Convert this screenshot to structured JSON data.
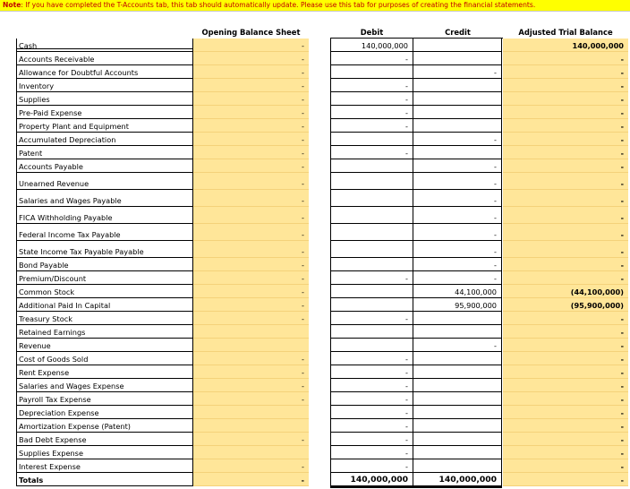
{
  "note": {
    "prefix": "Note",
    "text": ": If you have completed the T-Accounts tab, this tab should automatically update. Please use this tab for purposes of creating the financial statements."
  },
  "headers": {
    "opening": "Opening Balance Sheet",
    "debit": "Debit",
    "credit": "Credit",
    "adjusted": "Adjusted Trial Balance"
  },
  "rows": [
    {
      "label": "Cash",
      "opening": "-",
      "debit": "140,000,000",
      "credit": "",
      "adjusted": "140,000,000"
    },
    {
      "label": "Accounts Receivable",
      "opening": "-",
      "debit": "-",
      "credit": "",
      "adjusted": "-"
    },
    {
      "label": "Allowance for Doubtful Accounts",
      "opening": "-",
      "debit": "",
      "credit": "-",
      "adjusted": "-"
    },
    {
      "label": "Inventory",
      "opening": "-",
      "debit": "-",
      "credit": "",
      "adjusted": "-"
    },
    {
      "label": "Supplies",
      "opening": "-",
      "debit": "-",
      "credit": "",
      "adjusted": "-"
    },
    {
      "label": "Pre-Paid Expense",
      "opening": "-",
      "debit": "-",
      "credit": "",
      "adjusted": "-"
    },
    {
      "label": "Property Plant and Equipment",
      "opening": "-",
      "debit": "-",
      "credit": "",
      "adjusted": "-"
    },
    {
      "label": "Accumulated Depreciation",
      "opening": "-",
      "debit": "",
      "credit": "-",
      "adjusted": "-"
    },
    {
      "label": "Patent",
      "opening": "-",
      "debit": "-",
      "credit": "",
      "adjusted": "-"
    },
    {
      "label": "Accounts Payable",
      "opening": "-",
      "debit": "",
      "credit": "-",
      "adjusted": "-"
    },
    {
      "label": "Unearned Revenue",
      "opening": "-",
      "debit": "",
      "credit": "-",
      "adjusted": "-"
    },
    {
      "label": "Salaries and Wages Payable",
      "opening": "-",
      "debit": "",
      "credit": "-",
      "adjusted": "-"
    },
    {
      "label": "FICA Withholding Payable",
      "opening": "-",
      "debit": "",
      "credit": "-",
      "adjusted": "-"
    },
    {
      "label": "Federal Income Tax Payable",
      "opening": "-",
      "debit": "",
      "credit": "-",
      "adjusted": "-"
    },
    {
      "label": "State Income Tax Payable  Payable",
      "opening": "-",
      "debit": "",
      "credit": "-",
      "adjusted": "-"
    },
    {
      "label": "Bond Payable",
      "opening": "-",
      "debit": "",
      "credit": "-",
      "adjusted": "-"
    },
    {
      "label": "Premium/Discount",
      "opening": "-",
      "debit": "-",
      "credit": "-",
      "adjusted": "-"
    },
    {
      "label": "Common Stock",
      "opening": "-",
      "debit": "",
      "credit": "44,100,000",
      "adjusted": "(44,100,000)"
    },
    {
      "label": "Additional Paid In Capital",
      "opening": "-",
      "debit": "",
      "credit": "95,900,000",
      "adjusted": "(95,900,000)"
    },
    {
      "label": "Treasury Stock",
      "opening": "-",
      "debit": "-",
      "credit": "",
      "adjusted": "-"
    },
    {
      "label": "Retained Earnings",
      "opening": "",
      "debit": "",
      "credit": "",
      "adjusted": "-"
    },
    {
      "label": "Revenue",
      "opening": "",
      "debit": "",
      "credit": "-",
      "adjusted": "-"
    },
    {
      "label": "Cost of Goods Sold",
      "opening": "-",
      "debit": "-",
      "credit": "",
      "adjusted": "-"
    },
    {
      "label": "Rent Expense",
      "opening": "-",
      "debit": "-",
      "credit": "",
      "adjusted": "-"
    },
    {
      "label": "Salaries and Wages Expense",
      "opening": "-",
      "debit": "-",
      "credit": "",
      "adjusted": "-"
    },
    {
      "label": "Payroll Tax Expense",
      "opening": "-",
      "debit": "-",
      "credit": "",
      "adjusted": "-"
    },
    {
      "label": "Depreciation Expense",
      "opening": "",
      "debit": "-",
      "credit": "",
      "adjusted": "-"
    },
    {
      "label": "Amortization Expense (Patent)",
      "opening": "",
      "debit": "-",
      "credit": "",
      "adjusted": "-"
    },
    {
      "label": "Bad Debt Expense",
      "opening": "-",
      "debit": "-",
      "credit": "",
      "adjusted": "-"
    },
    {
      "label": "Supplies Expense",
      "opening": "",
      "debit": "-",
      "credit": "",
      "adjusted": "-"
    },
    {
      "label": "Interest Expense",
      "opening": "-",
      "debit": "-",
      "credit": "",
      "adjusted": "-"
    }
  ],
  "totals": {
    "label": "Totals",
    "opening": "-",
    "debit": "140,000,000",
    "credit": "140,000,000",
    "adjusted": "-"
  },
  "colors": {
    "note_bg": "#ffff00",
    "note_text": "#c00000",
    "highlight": "#ffe699"
  }
}
